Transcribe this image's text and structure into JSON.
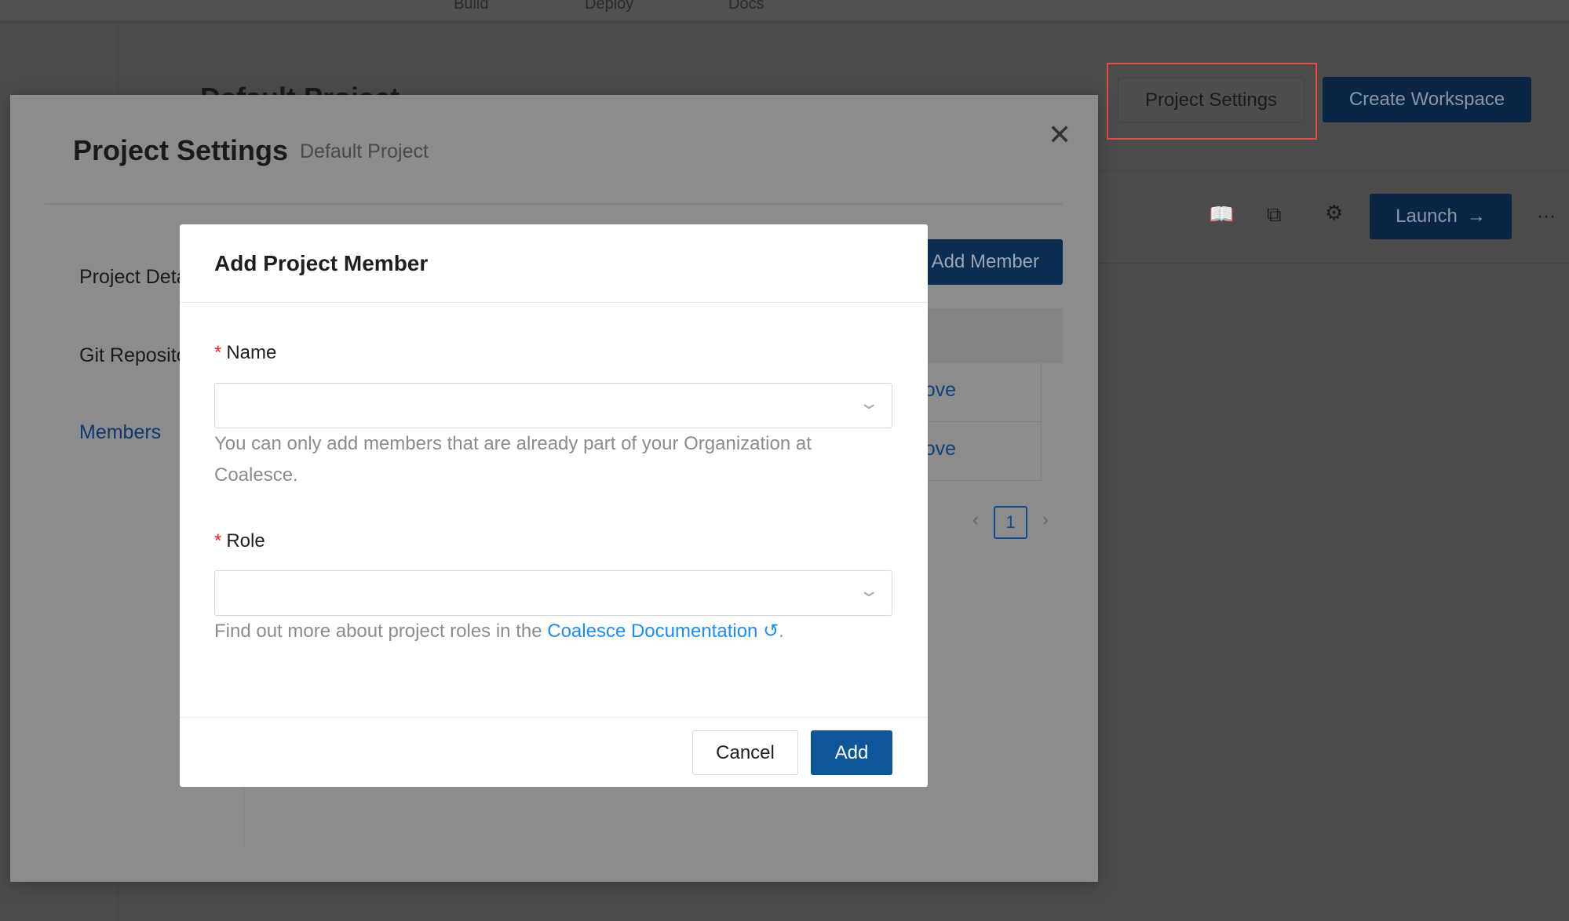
{
  "topnav": {
    "items": [
      "Build",
      "Deploy",
      "Docs"
    ]
  },
  "page": {
    "title": "Default Project",
    "project_settings_label": "Project Settings",
    "create_workspace_label": "Create Workspace",
    "launch_label": "Launch",
    "more": "···"
  },
  "settings_modal": {
    "title": "Project Settings",
    "subtitle": "Default Project",
    "sidebar": [
      "Project Details",
      "Git Repository",
      "Members"
    ],
    "add_member_label": "Add Member",
    "remove_label": "Remove",
    "page": "1"
  },
  "dialog": {
    "title": "Add Project Member",
    "name_label": "Name",
    "name_help": "You can only add members that are already part of your Organization at Coalesce.",
    "role_label": "Role",
    "role_help_prefix": "Find out more about project roles in the ",
    "role_help_link": "Coalesce Documentation",
    "role_help_suffix": ".",
    "cancel_label": "Cancel",
    "add_label": "Add",
    "required_mark": "*"
  },
  "colors": {
    "primary": "#0f5599",
    "link": "#1a8cff",
    "required": "#f5222d",
    "highlight": "#e84a4a"
  }
}
